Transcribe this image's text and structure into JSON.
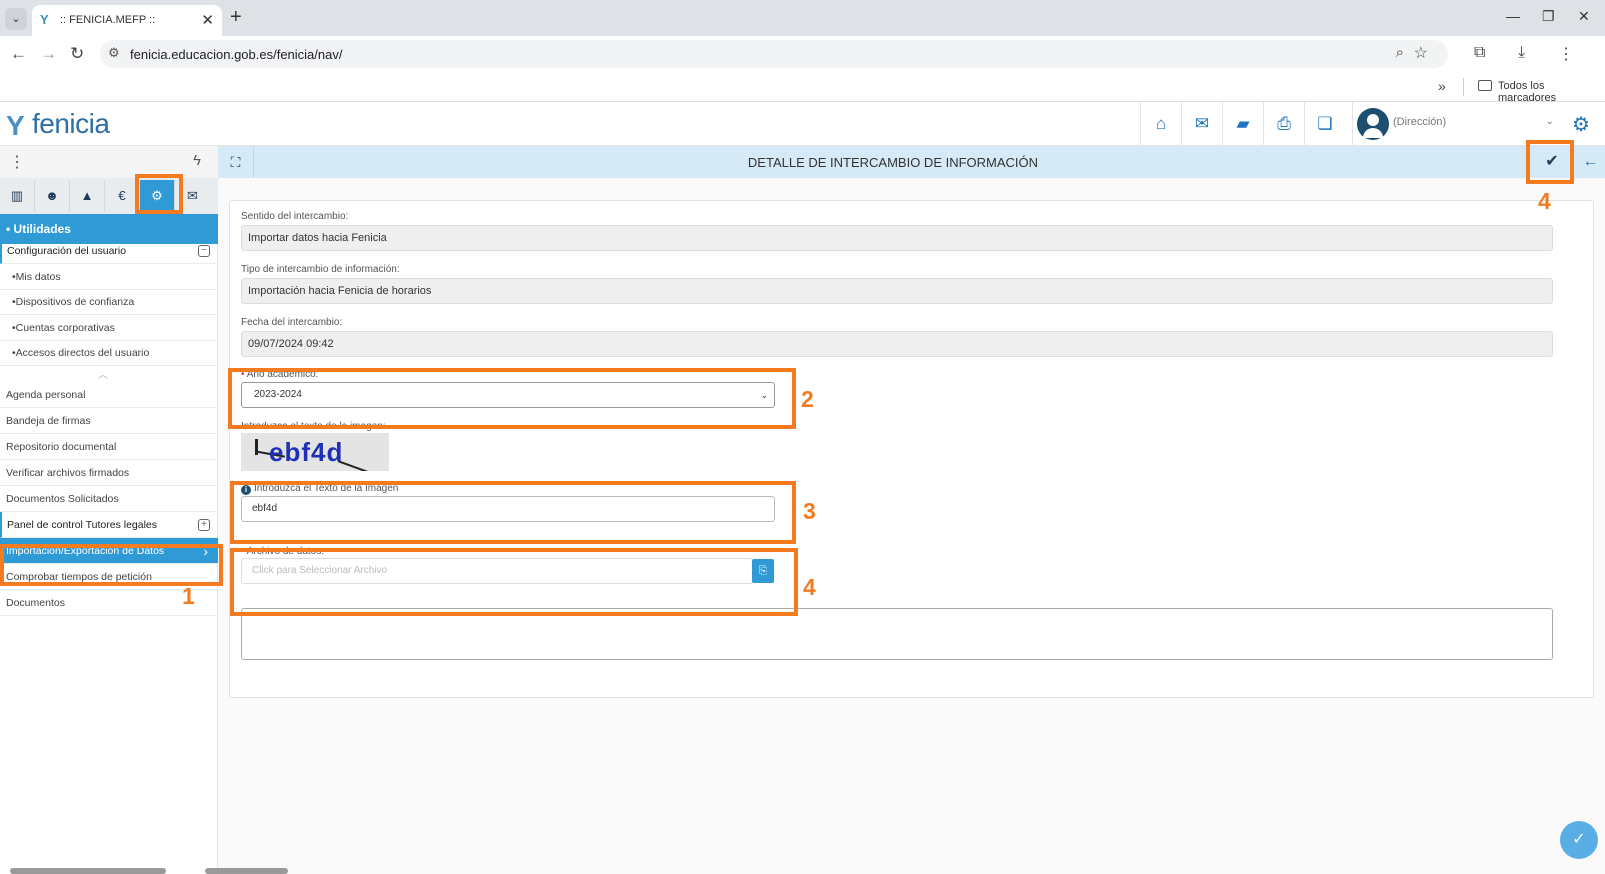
{
  "browser": {
    "tab_title": ":: FENICIA.MEFP ::",
    "url": "fenicia.educacion.gob.es/fenicia/nav/",
    "bookmarks_label": "Todos los marcadores"
  },
  "app": {
    "logo_text": "fenicia",
    "user_role": "(Dirección)"
  },
  "sidebar": {
    "section_title": "• Utilidades",
    "group_config": "Configuración del usuario",
    "config_items": [
      "•Mis datos",
      "•Dispositivos de confianza",
      "•Cuentas corporativas",
      "•Accesos directos del usuario"
    ],
    "items": [
      "Agenda personal",
      "Bandeja de firmas",
      "Repositorio documental",
      "Verificar archivos firmados",
      "Documentos Solicitados"
    ],
    "group_tutores": "Panel de control Tutores legales",
    "active_item": "Importación/Exportación de Datos",
    "items_after": [
      "Comprobar tiempos de petición",
      "Documentos"
    ]
  },
  "content": {
    "title": "DETALLE DE INTERCAMBIO DE INFORMACIÓN"
  },
  "form": {
    "sentido_label": "Sentido del intercambio:",
    "sentido_value": "Importar datos hacia Fenicia",
    "tipo_label": "Tipo de intercambio de información:",
    "tipo_value": "Importación hacia Fenicia de horarios",
    "fecha_label": "Fecha del intercambio:",
    "fecha_value": "09/07/2024 09:42",
    "anio_label": "Año académico:",
    "anio_value": "2023-2024",
    "captcha_label": "Introduzca el texto de la imagen:",
    "captcha_text": "ebf4d",
    "texto_label": "Introduzca el Texto de la Imagen",
    "texto_value": "ebf4d",
    "archivo_label": "Archivo de datos:",
    "archivo_placeholder": "Click para Seleccionar Archivo"
  },
  "annotations": {
    "n1": "1",
    "n2": "2",
    "n3": "3",
    "n4a": "4",
    "n4b": "4",
    "color": "#f47b20"
  }
}
